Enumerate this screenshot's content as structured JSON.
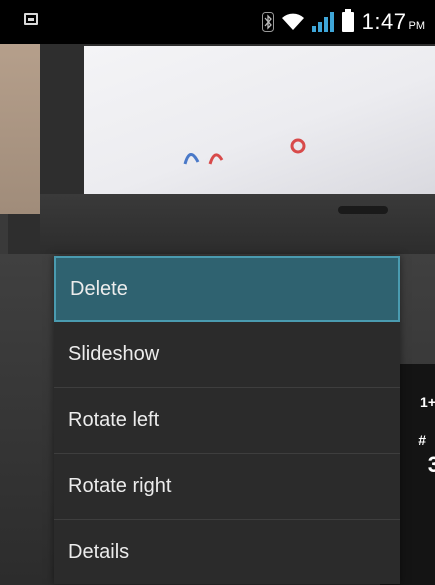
{
  "status_bar": {
    "time": "1:47",
    "ampm": "PM",
    "icons": [
      "notification-icon",
      "bluetooth-icon",
      "wifi-icon",
      "signal-icon",
      "battery-icon"
    ]
  },
  "context_menu": {
    "items": [
      {
        "label": "Delete",
        "selected": true
      },
      {
        "label": "Slideshow",
        "selected": false
      },
      {
        "label": "Rotate left",
        "selected": false
      },
      {
        "label": "Rotate right",
        "selected": false
      },
      {
        "label": "Details",
        "selected": false
      }
    ]
  },
  "background": {
    "phone_keys": [
      "1+",
      "#",
      "3"
    ]
  },
  "colors": {
    "menu_background": "#2b2b2b",
    "menu_selected": "#2f6270",
    "menu_selected_border": "#4a9bb0",
    "status_bar": "#000000",
    "menu_text": "#ececec"
  }
}
